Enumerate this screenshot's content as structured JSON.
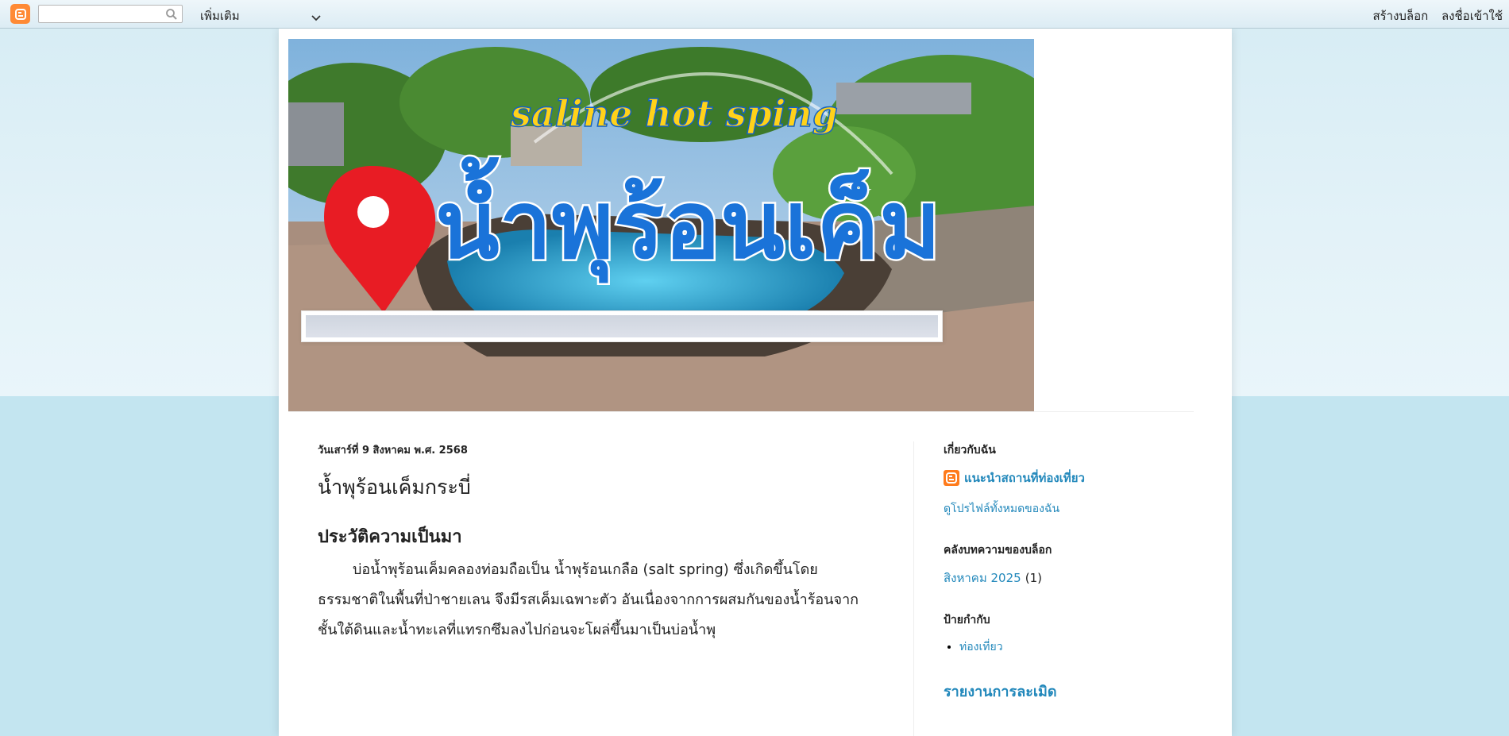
{
  "navbar": {
    "search_placeholder": "",
    "more_label": "เพิ่มเติม",
    "create_blog": "สร้างบล็อก",
    "sign_in": "ลงชื่อเข้าใช้"
  },
  "header_image": {
    "script_title": "saline hot sping",
    "thai_title": "น้ำพุร้อนเค็ม"
  },
  "post": {
    "date": "วันเสาร์ที่ 9 สิงหาคม พ.ศ. 2568",
    "title": "น้ำพุร้อนเค็มกระบี่",
    "heading": "ประวัติความเป็นมา",
    "body": "บ่อน้ำพุร้อนเค็มคลองท่อมถือเป็น น้ำพุร้อนเกลือ (salt spring) ซึ่งเกิดขึ้นโดยธรรมชาติในพื้นที่ป่าชายเลน จึงมีรสเค็มเฉพาะตัว อันเนื่องจากการผสมกันของน้ำร้อนจากชั้นใต้ดินและน้ำทะเลที่แทรกซึมลงไปก่อนจะโผล่ขึ้นมาเป็นบ่อน้ำพุ"
  },
  "sidebar": {
    "about_title": "เกี่ยวกับฉัน",
    "profile_name": "แนะนำสถานที่ท่องเที่ยว",
    "view_profile": "ดูโปรไฟล์ทั้งหมดของฉัน",
    "archive_title": "คลังบทความของบล็อก",
    "archive_month": "สิงหาคม 2025",
    "archive_count": "(1)",
    "labels_title": "ป้ายกำกับ",
    "labels": [
      "ท่องเที่ยว"
    ],
    "report_abuse": "รายงานการละเมิด"
  },
  "colors": {
    "link": "#2288bb",
    "blogger_orange": "#ff8a35",
    "background": "#c3e5f0"
  }
}
